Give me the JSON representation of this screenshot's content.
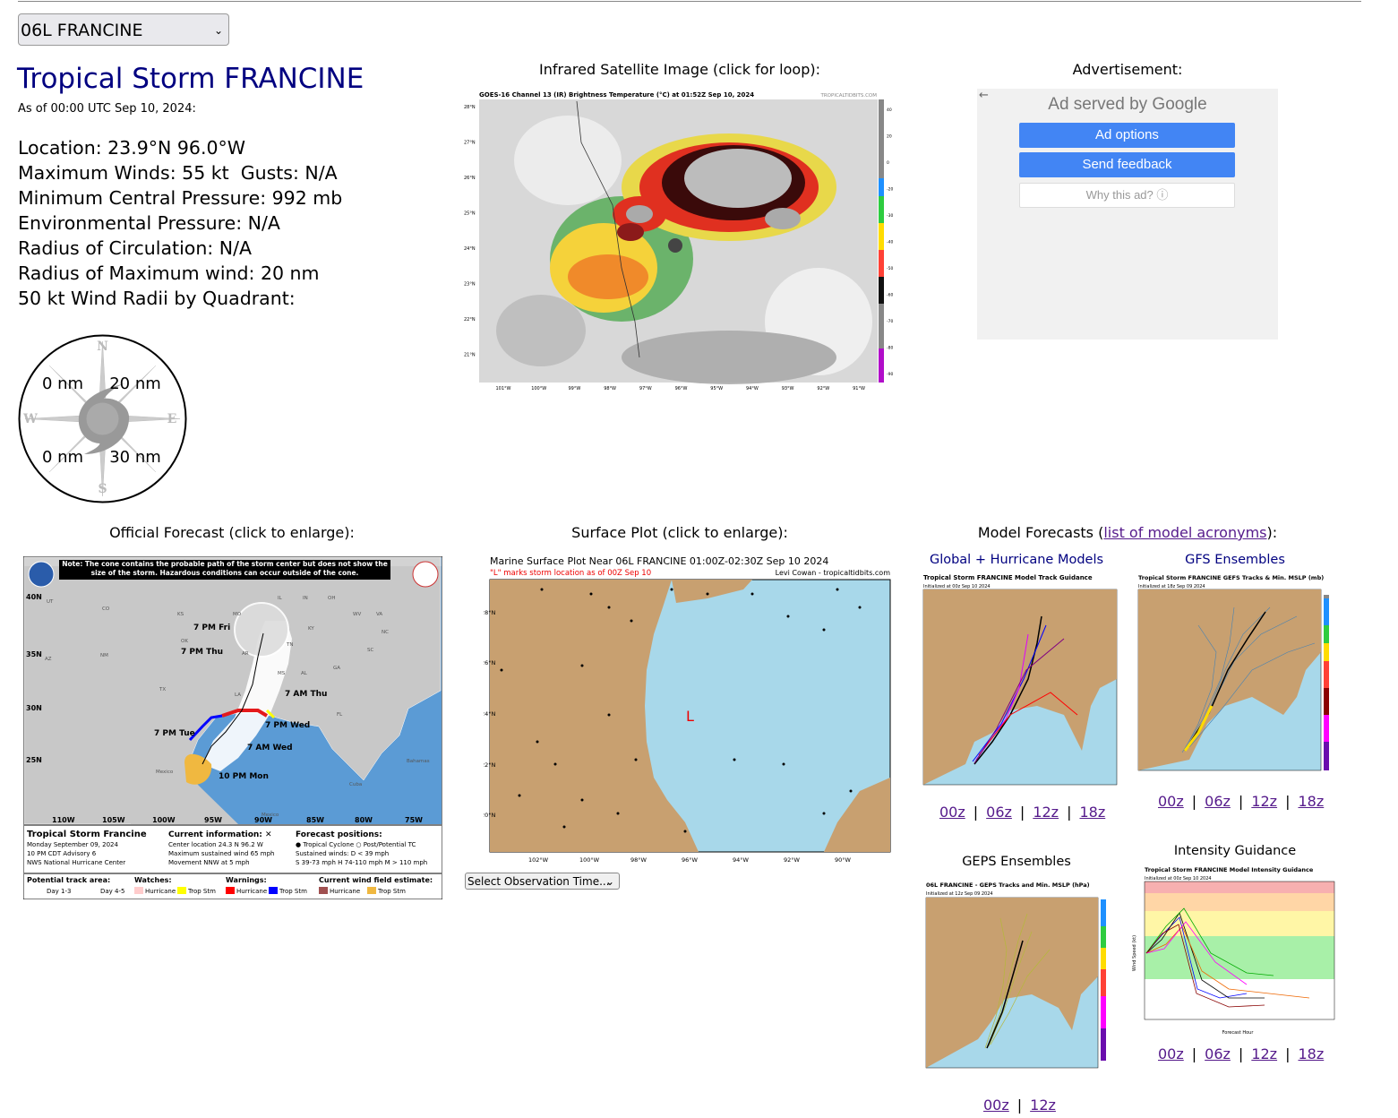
{
  "storm_select": {
    "value": "06L FRANCINE"
  },
  "header": {
    "title": "Tropical Storm FRANCINE",
    "as_of": "As of 00:00 UTC Sep 10, 2024:"
  },
  "info": {
    "location": "Location: 23.9°N 96.0°W",
    "winds": "Maximum Winds: 55 kt  Gusts: N/A",
    "pressure": "Minimum Central Pressure: 992 mb",
    "env_pressure": "Environmental Pressure: N/A",
    "radius_circ": "Radius of Circulation: N/A",
    "rmw": "Radius of Maximum wind: 20 nm",
    "wind_radii_label": "50 kt Wind Radii by Quadrant:"
  },
  "compass": {
    "n": "N",
    "s": "S",
    "e": "E",
    "w": "W",
    "nw": "0 nm",
    "ne": "20 nm",
    "sw": "0 nm",
    "se": "30 nm"
  },
  "satellite": {
    "caption": "Infrared Satellite Image (click for loop):",
    "image_title": "GOES-16 Channel 13 (IR) Brightness Temperature (°C) at 01:52Z Sep 10, 2024",
    "credit": "TROPICALTIDBITS.COM",
    "lat_labels": [
      "28°N",
      "27°N",
      "26°N",
      "25°N",
      "24°N",
      "23°N",
      "22°N",
      "21°N"
    ],
    "lon_labels": [
      "101°W",
      "100°W",
      "99°W",
      "98°W",
      "97°W",
      "96°W",
      "95°W",
      "94°W",
      "93°W",
      "92°W",
      "91°W"
    ],
    "scale_labels": [
      "40",
      "20",
      "0",
      "-20",
      "-30",
      "-40",
      "-50",
      "-60",
      "-70",
      "-80",
      "-90"
    ]
  },
  "ad": {
    "caption": "Advertisement:",
    "served_by": "Ad served by Google",
    "options": "Ad options",
    "feedback": "Send feedback",
    "why": "Why this ad? ⓘ",
    "back": "←"
  },
  "official": {
    "caption": "Official Forecast (click to enlarge):",
    "note": "Note: The cone contains the probable path of the storm center but does not show the size of the storm. Hazardous conditions can occur outside of the cone.",
    "points": [
      "7 PM Fri",
      "7 PM Thu",
      "7 AM Thu",
      "7 PM Wed",
      "7 AM Wed",
      "7 PM Tue",
      "10 PM Mon"
    ],
    "lat_labels": [
      "40N",
      "35N",
      "30N",
      "25N"
    ],
    "lon_labels": [
      "110W",
      "105W",
      "100W",
      "95W",
      "90W",
      "85W",
      "80W",
      "75W"
    ],
    "states": [
      "UT",
      "CO",
      "KS",
      "MO",
      "IL",
      "IN",
      "OH",
      "WV",
      "VA",
      "NC",
      "SC",
      "GA",
      "AL",
      "MS",
      "LA",
      "AR",
      "TN",
      "KY",
      "OK",
      "NM",
      "AZ",
      "TX",
      "FL"
    ],
    "countries": [
      "Mexico",
      "Cuba",
      "Bahamas",
      "Mexico"
    ],
    "footer_title": "Tropical Storm Francine",
    "footer_date": "Monday September 09, 2024",
    "footer_adv": "10 PM CDT Advisory 6",
    "footer_nhc": "NWS National Hurricane Center",
    "current_label": "Current information: ✕",
    "current_loc": "Center location 24.3 N 96.2 W",
    "current_wind": "Maximum sustained wind 65 mph",
    "current_move": "Movement NNW at 5 mph",
    "fp_label": "Forecast positions:",
    "fp_line1": "● Tropical Cyclone   ○ Post/Potential TC",
    "fp_line2": "Sustained winds:          D < 39 mph",
    "fp_line3": "S 39-73 mph  H 74-110 mph  M > 110 mph",
    "legend_track": "Potential track area:",
    "legend_day13": "Day 1-3",
    "legend_day45": "Day 4-5",
    "legend_watches": "Watches:",
    "legend_hur": "Hurricane",
    "legend_trop": "Trop Stm",
    "legend_warnings": "Warnings:",
    "legend_wind": "Current wind field estimate:"
  },
  "surface": {
    "caption": "Surface Plot (click to enlarge):",
    "title": "Marine Surface Plot Near 06L FRANCINE 01:00Z-02:30Z Sep 10 2024",
    "subtitle": "\"L\" marks storm location as of 00Z Sep 10",
    "credit": "Levi Cowan - tropicaltidbits.com",
    "lat_labels": [
      "28°N",
      "26°N",
      "24°N",
      "22°N",
      "20°N"
    ],
    "lon_labels": [
      "102°W",
      "100°W",
      "98°W",
      "96°W",
      "94°W",
      "92°W",
      "90°W"
    ],
    "storm_marker": "L",
    "obs_select": "Select Observation Time..."
  },
  "models": {
    "caption_prefix": "Model Forecasts (",
    "caption_link": "list of model acronyms",
    "caption_suffix": "):",
    "global": {
      "caption": "Global + Hurricane Models",
      "title": "Tropical Storm FRANCINE Model Track Guidance",
      "subtitle": "Initialized at 00z Sep 10 2024",
      "links": [
        "00z",
        "06z",
        "12z",
        "18z"
      ]
    },
    "gfs": {
      "caption": "GFS Ensembles",
      "title": "Tropical Storm FRANCINE GEFS Tracks & Min. MSLP (mb)",
      "subtitle": "Initialized at 18z Sep 09 2024",
      "links": [
        "00z",
        "06z",
        "12z",
        "18z"
      ]
    },
    "geps": {
      "caption": "GEPS Ensembles",
      "title": "06L FRANCINE - GEPS Tracks and Min. MSLP (hPa)",
      "subtitle": "Initialized at 12z Sep 09 2024",
      "links": [
        "00z",
        "12z"
      ]
    },
    "intensity": {
      "caption": "Intensity Guidance",
      "title": "Tropical Storm FRANCINE Model Intensity Guidance",
      "subtitle": "Initialized at 00z Sep 10 2024",
      "xlabel": "Forecast Hour",
      "ylabel": "Wind Speed (kt)",
      "links": [
        "00z",
        "06z",
        "12z",
        "18z"
      ]
    }
  },
  "colors": {
    "title": "#000080",
    "link": "#551a8b",
    "ocean": "#a8d8ea",
    "land": "#c8a070",
    "ad_button": "#4285f4"
  }
}
